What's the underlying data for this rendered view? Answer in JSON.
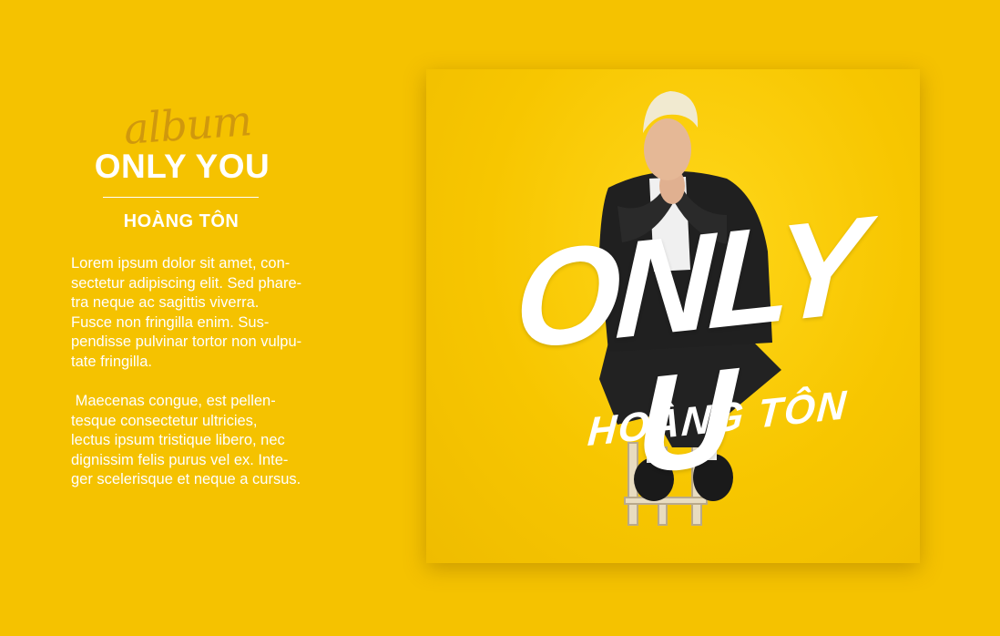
{
  "album": {
    "script_label": "album",
    "title": "ONLY YOU",
    "artist": "HOÀNG TÔN"
  },
  "description": {
    "paragraph1": [
      "Lorem ipsum dolor sit amet, con-",
      "sectetur adipiscing elit. Sed phare-",
      "tra neque ac sagittis viverra.",
      "Fusce non fringilla enim. Sus-",
      "pendisse pulvinar tortor non vulpu-",
      "tate fringilla."
    ],
    "paragraph2": [
      " Maecenas congue, est pellen-",
      "tesque consectetur ultricies,",
      "lectus ipsum tristique libero, nec",
      "dignissim felis purus vel ex. Inte-",
      "ger scelerisque et neque a cursus."
    ]
  },
  "cover": {
    "title": "ONLY U",
    "artist": "HOÀNG TÔN"
  },
  "colors": {
    "background": "#f5c200",
    "text": "#ffffff",
    "script_accent": "#c48a12"
  }
}
